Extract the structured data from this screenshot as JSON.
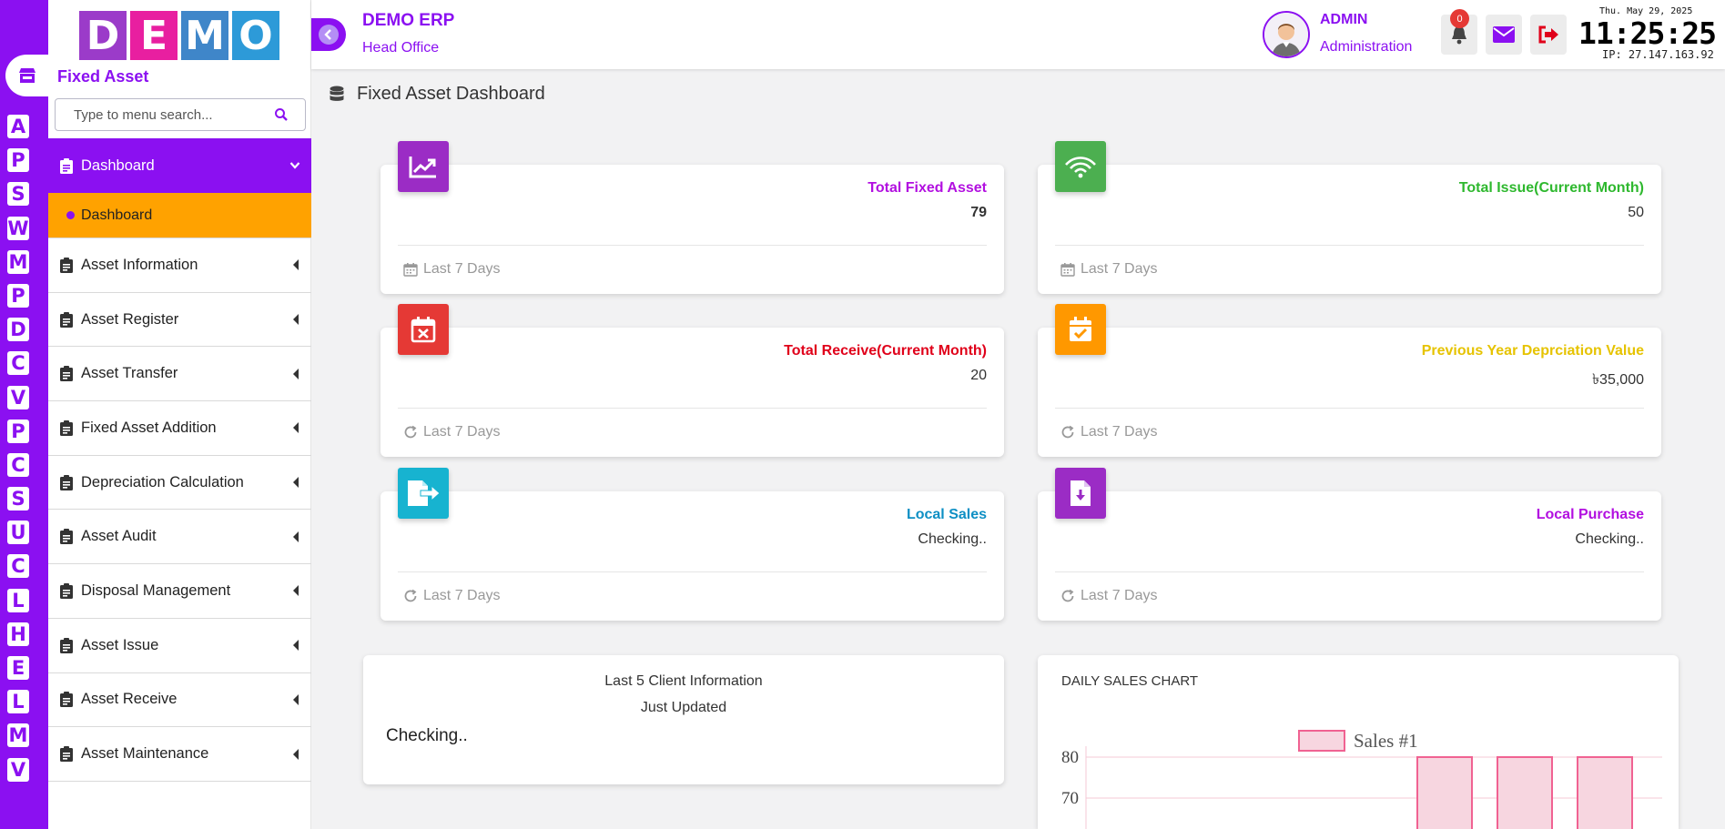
{
  "rail": {
    "letters": [
      "A",
      "P",
      "S",
      "W",
      "M",
      "P",
      "D",
      "C",
      "V",
      "P",
      "C",
      "S",
      "U",
      "C",
      "L",
      "H",
      "E",
      "L",
      "M",
      "V"
    ]
  },
  "sidebar": {
    "logo_letters": [
      "D",
      "E",
      "M",
      "O"
    ],
    "logo_colors": [
      "#9b3bc9",
      "#e81fa0",
      "#3f86c9",
      "#2d9ad8"
    ],
    "module_title": "Fixed Asset",
    "search_placeholder": "Type to menu search...",
    "items": [
      {
        "label": "Dashboard",
        "active": true
      },
      {
        "label": "Asset Information"
      },
      {
        "label": "Asset Register"
      },
      {
        "label": "Asset Transfer"
      },
      {
        "label": "Fixed Asset Addition"
      },
      {
        "label": "Depreciation Calculation"
      },
      {
        "label": "Asset Audit"
      },
      {
        "label": "Disposal Management"
      },
      {
        "label": "Asset Issue"
      },
      {
        "label": "Asset Receive"
      },
      {
        "label": "Asset Maintenance"
      }
    ],
    "sub_item": "Dashboard"
  },
  "header": {
    "app_name": "DEMO ERP",
    "app_sub": "Head Office",
    "user_name": "ADMIN",
    "user_role": "Administration",
    "notification_count": "0",
    "date": "Thu. May 29, 2025",
    "time": "11:25:25",
    "ip": "IP: 27.147.163.92"
  },
  "page_title": "Fixed Asset Dashboard",
  "cards": [
    {
      "title": "Total Fixed Asset",
      "value": "79",
      "footer": "Last 7 Days",
      "color": "#b20fe0",
      "icon": "chart-up-icon",
      "icon_bg": "#9b2cc5"
    },
    {
      "title": "Total Issue(Current Month)",
      "value": "50",
      "footer": "Last 7 Days",
      "color": "#2eb82e",
      "icon": "wifi-icon",
      "icon_bg": "#4caf50"
    },
    {
      "title": "Total Receive(Current Month)",
      "value": "20",
      "footer": "Last 7 Days",
      "color": "#e0001a",
      "icon": "calendar-x-icon",
      "icon_bg": "#e53935"
    },
    {
      "title": "Previous Year Deprciation Value",
      "value": "৳35,000",
      "footer": "Last 7 Days",
      "color": "#e6c300",
      "icon": "calendar-check-icon",
      "icon_bg": "#ff9800"
    },
    {
      "title": "Local Sales",
      "value": "Checking..",
      "footer": "Last 7 Days",
      "color": "#0d8fc4",
      "icon": "file-export-icon",
      "icon_bg": "#17b3d0"
    },
    {
      "title": "Local Purchase",
      "value": "Checking..",
      "footer": "Last 7 Days",
      "color": "#b20fe0",
      "icon": "file-download-icon",
      "icon_bg": "#9b2cc5"
    }
  ],
  "client_panel": {
    "title": "Last 5 Client Information",
    "subtitle": "Just Updated",
    "status": "Checking.."
  },
  "chart_panel": {
    "title": "DAILY SALES CHART"
  },
  "chart_data": {
    "type": "bar",
    "title": "",
    "series": [
      {
        "name": "Sales #1",
        "values": [
          80,
          80,
          80
        ]
      }
    ],
    "y_ticks_visible": [
      "80",
      "70"
    ],
    "bar_color": "#f7d6e0",
    "bar_border": "#f06292"
  }
}
